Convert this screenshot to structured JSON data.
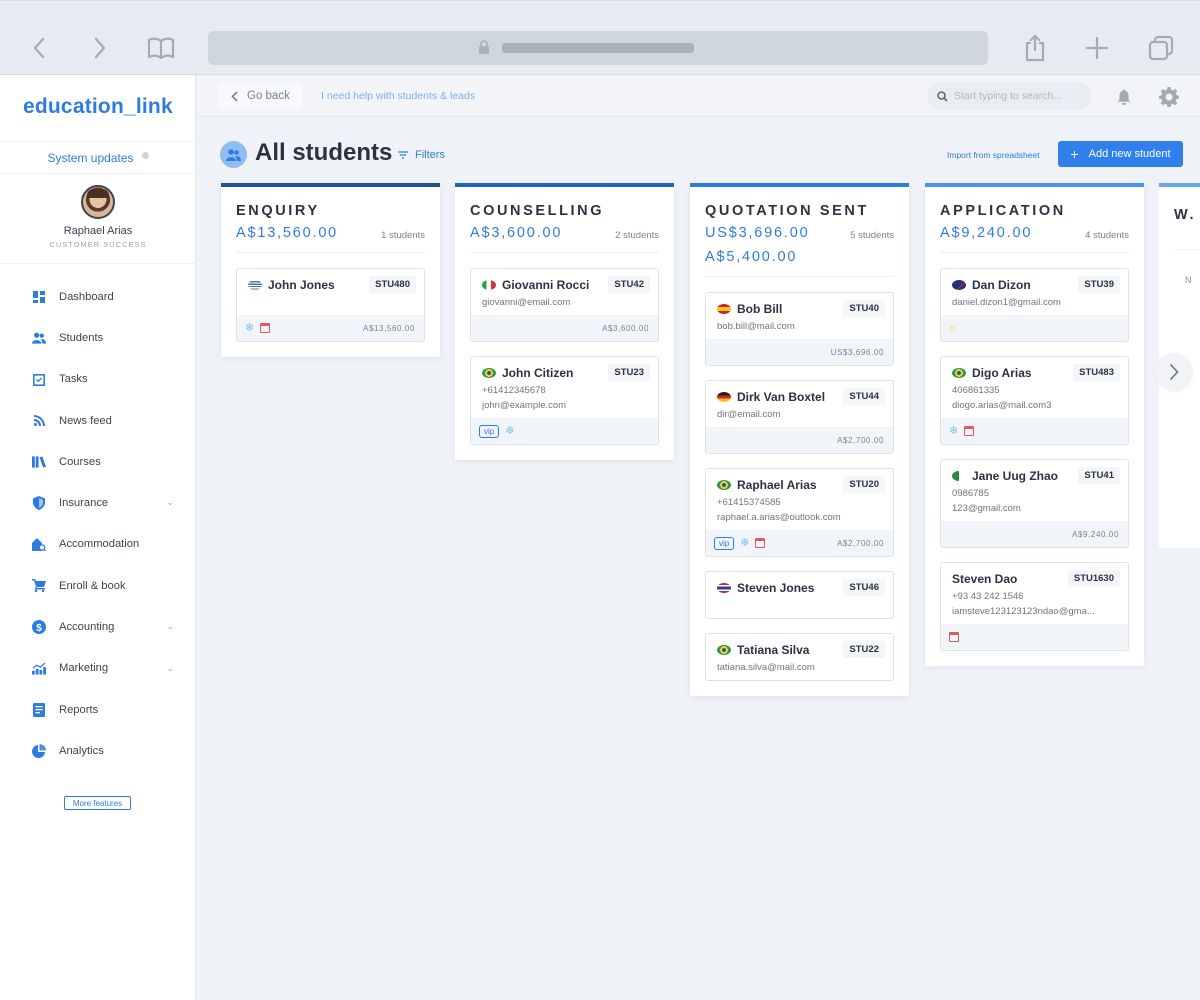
{
  "browser": {
    "back_icon": "chevron-left",
    "forward_icon": "chevron-right",
    "bookmarks_icon": "book",
    "share_icon": "share",
    "new_tab_icon": "plus",
    "tabs_icon": "tabs"
  },
  "sidebar": {
    "logo": "education_link",
    "system_updates": "System updates",
    "profile": {
      "name": "Raphael Arias",
      "role": "CUSTOMER SUCCESS"
    },
    "items": [
      {
        "label": "Dashboard",
        "icon": "dashboard-icon",
        "has_submenu": false
      },
      {
        "label": "Students",
        "icon": "students-icon",
        "has_submenu": false
      },
      {
        "label": "Tasks",
        "icon": "tasks-icon",
        "has_submenu": false
      },
      {
        "label": "News feed",
        "icon": "rss-icon",
        "has_submenu": false
      },
      {
        "label": "Courses",
        "icon": "courses-icon",
        "has_submenu": false
      },
      {
        "label": "Insurance",
        "icon": "shield-icon",
        "has_submenu": true
      },
      {
        "label": "Accommodation",
        "icon": "accommodation-icon",
        "has_submenu": false
      },
      {
        "label": "Enroll & book",
        "icon": "cart-icon",
        "has_submenu": false
      },
      {
        "label": "Accounting",
        "icon": "dollar-icon",
        "has_submenu": true
      },
      {
        "label": "Marketing",
        "icon": "marketing-icon",
        "has_submenu": true
      },
      {
        "label": "Reports",
        "icon": "reports-icon",
        "has_submenu": false
      },
      {
        "label": "Analytics",
        "icon": "analytics-icon",
        "has_submenu": false
      }
    ],
    "more_features": "More features"
  },
  "topbar": {
    "go_back": "Go back",
    "help_link": "I need help with students & leads",
    "search_placeholder": "Start typing to search...",
    "search_value": ""
  },
  "page": {
    "title": "All students",
    "filters": "Filters",
    "import": "Import from spreadsheet",
    "add_student": "Add new student"
  },
  "colors": {
    "accent": "#2f7ce0",
    "column_borders": [
      "#1f5597",
      "#2064b8",
      "#2f7ce0",
      "#4a92ec",
      "#6aa6f2"
    ]
  },
  "columns": [
    {
      "title": "ENQUIRY",
      "amounts": [
        "A$13,560.00"
      ],
      "count": "1 students",
      "cards": [
        {
          "name": "John Jones",
          "id": "STU480",
          "flag": "uruguay",
          "lines": [],
          "tags": [
            "snowflake",
            "calendar"
          ],
          "amount": "A$13,560.00"
        }
      ]
    },
    {
      "title": "COUNSELLING",
      "amounts": [
        "A$3,600.00"
      ],
      "count": "2 students",
      "cards": [
        {
          "name": "Giovanni Rocci",
          "id": "STU42",
          "flag": "italy",
          "lines": [
            "giovanni@email.com"
          ],
          "tags": [],
          "amount": "A$3,600.00"
        },
        {
          "name": "John Citizen",
          "id": "STU23",
          "flag": "brazil",
          "lines": [
            "+61412345678",
            "john@example.com"
          ],
          "tags": [
            "vip",
            "snowflake"
          ],
          "amount": ""
        }
      ]
    },
    {
      "title": "QUOTATION SENT",
      "amounts": [
        "US$3,696.00",
        "A$5,400.00"
      ],
      "count": "5 students",
      "cards": [
        {
          "name": "Bob Bill",
          "id": "STU40",
          "flag": "spain",
          "lines": [
            "bob.bill@mail.com"
          ],
          "tags": [],
          "amount": "US$3,696.00"
        },
        {
          "name": "Dirk Van Boxtel",
          "id": "STU44",
          "flag": "germany",
          "lines": [
            "dir@email.com"
          ],
          "tags": [],
          "amount": "A$2,700.00"
        },
        {
          "name": "Raphael Arias",
          "id": "STU20",
          "flag": "brazil",
          "lines": [
            "+61415374585",
            "raphael.a.arias@outlook.com"
          ],
          "tags": [
            "vip",
            "snowflake",
            "calendar"
          ],
          "amount": "A$2,700.00"
        },
        {
          "name": "Steven Jones",
          "id": "STU46",
          "flag": "thailand",
          "lines": [],
          "tags": null,
          "amount": ""
        },
        {
          "name": "Tatiana Silva",
          "id": "STU22",
          "flag": "brazil",
          "lines": [
            "tatiana.silva@mail.com"
          ],
          "tags": null,
          "amount": ""
        }
      ]
    },
    {
      "title": "APPLICATION",
      "amounts": [
        "A$9,240.00"
      ],
      "count": "4 students",
      "cards": [
        {
          "name": "Dan Dizon",
          "id": "STU39",
          "flag": "australia",
          "lines": [
            "daniel.dizon1@gmail.com"
          ],
          "tags": [
            "flame"
          ],
          "amount": ""
        },
        {
          "name": "Digo Arias",
          "id": "STU483",
          "flag": "brazil",
          "lines": [
            "406861335",
            "diogo.arias@mail.com3"
          ],
          "tags": [
            "snowflake",
            "calendar"
          ],
          "amount": ""
        },
        {
          "name": "Jane Uug Zhao",
          "id": "STU41",
          "flag": "algeria",
          "lines": [
            "0986785",
            "123@gmail.com"
          ],
          "tags": [],
          "amount": "A$9,240.00"
        },
        {
          "name": "Steven Dao",
          "id": "STU1630",
          "flag": "",
          "lines": [
            "+93 43 242 1546",
            "iamsteve123123123ndao@gma..."
          ],
          "tags": [
            "calendar"
          ],
          "amount": ""
        }
      ]
    }
  ],
  "next_column": {
    "title": "W.",
    "partial_text": "N"
  }
}
